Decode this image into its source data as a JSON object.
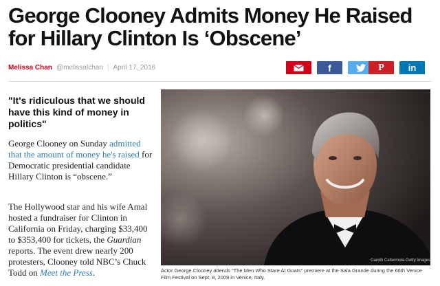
{
  "article": {
    "headline": "George Clooney Admits Money He Raised for Hillary Clinton Is ‘Obscene’",
    "byline": {
      "author": "Melissa Chan",
      "handle": "@melissalchan",
      "separator": "|",
      "date": "April 17, 2016"
    },
    "share": {
      "email_icon": "email-icon",
      "facebook_icon": "facebook-icon",
      "facebook_glyph": "f",
      "twitter_icon": "twitter-icon",
      "pinterest_icon": "pinterest-icon",
      "pinterest_glyph": "P",
      "linkedin_icon": "linkedin-icon",
      "linkedin_glyph": "in"
    },
    "pullquote": "\"It's ridiculous that we should have this kind of money in politics\"",
    "paragraph1": {
      "before": "George Clooney on Sunday ",
      "link": "admitted that the amount of money he's raised",
      "after": " for Democratic presidential candidate Hillary Clinton is “obscene.”"
    },
    "paragraph2": {
      "text1": "The Hollywood star and his wife Amal hosted a fundraiser for Clinton in California on Friday, charging $33,400 to $353,400 for tickets, the ",
      "italic": "Guardian",
      "text2": " reports. The event drew nearly 200 protesters, Clooney told NBC’s Chuck Todd on ",
      "link": "Meet the Press",
      "text3": "."
    },
    "photo": {
      "credit": "Gareth Cattermole-Getty Images",
      "caption": "Actor George Clooney attends \"The Men Who Stare At Goats\" premiere at the Sala Grande during the 66th Venice Film Festival on Sept. 8, 2009 in Venice, Italy."
    }
  },
  "colors": {
    "brand_red": "#d0021b",
    "facebook": "#3b5998",
    "twitter": "#55acee",
    "pinterest": "#cb2027",
    "linkedin": "#0077b5",
    "link": "#2a7ab7"
  }
}
